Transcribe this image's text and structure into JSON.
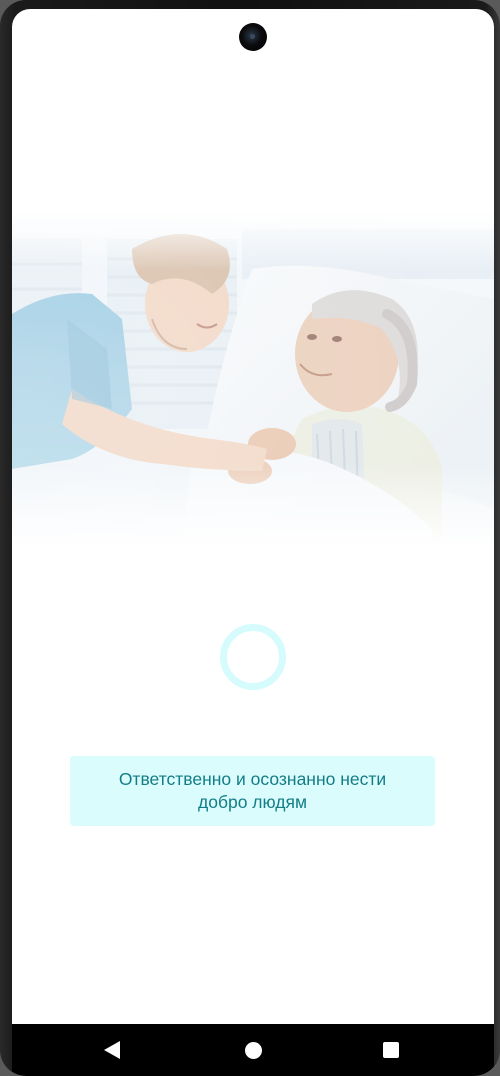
{
  "slogan": {
    "text": "Ответственно и осознанно нести добро людям"
  },
  "hero": {
    "image_icon": "nurse-caring-for-elderly-patient-image"
  },
  "loading": {
    "icon": "loading-spinner-icon",
    "color": "#d6fbfc"
  },
  "colors": {
    "accent_text": "#137d86",
    "slogan_background": "#dbfcfd"
  },
  "navbar": {
    "back_icon": "back-triangle-icon",
    "home_icon": "home-circle-icon",
    "recents_icon": "recents-square-icon"
  }
}
